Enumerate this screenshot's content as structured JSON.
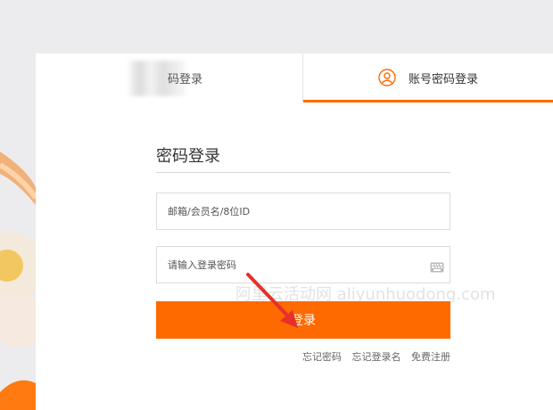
{
  "tabs": {
    "qr_label": "码登录",
    "password_label": "账号密码登录"
  },
  "form": {
    "title": "密码登录",
    "account_placeholder": "邮箱/会员名/8位ID",
    "password_placeholder": "请输入登录密码",
    "login_button": "登录"
  },
  "links": {
    "forgot_password": "忘记密码",
    "forgot_username": "忘记登录名",
    "register": "免费注册"
  },
  "watermark": "阿里云活动网 aliyunhuodong.com",
  "colors": {
    "accent": "#ff6a00",
    "annotation_arrow": "#e8302a"
  }
}
